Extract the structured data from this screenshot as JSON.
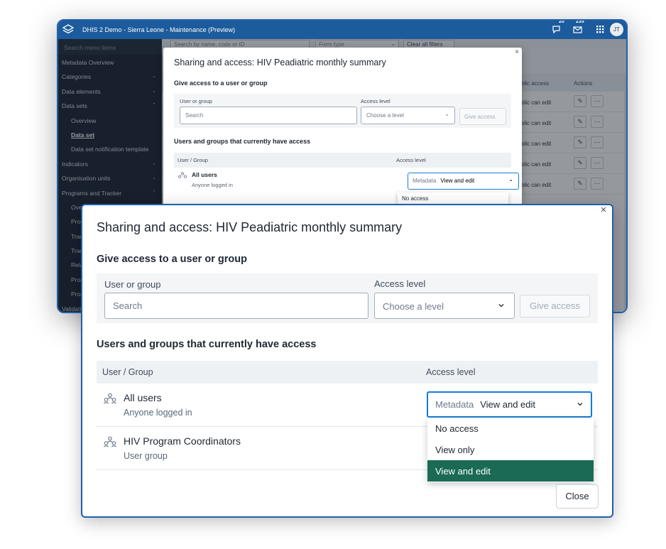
{
  "app": {
    "title": "DHIS 2 Demo - Sierra Leone - Maintenance (Preview)",
    "interpretations_count": "20",
    "messages_count": "235",
    "avatar_initials": "JT"
  },
  "sidebar": {
    "search_placeholder": "Search menu items",
    "items": [
      {
        "label": "Metadata Overview"
      },
      {
        "label": "Categories"
      },
      {
        "label": "Data elements"
      },
      {
        "label": "Data sets"
      },
      {
        "label": "Overview"
      },
      {
        "label": "Data set"
      },
      {
        "label": "Data set notification template"
      },
      {
        "label": "Indicators"
      },
      {
        "label": "Organisation units"
      },
      {
        "label": "Programs and Tracker"
      },
      {
        "label": "Ove"
      },
      {
        "label": "Prog"
      },
      {
        "label": "Trac"
      },
      {
        "label": "Trac"
      },
      {
        "label": "Rela"
      },
      {
        "label": "Prog"
      },
      {
        "label": "Prog"
      },
      {
        "label": "Validati"
      }
    ]
  },
  "filters": {
    "search_placeholder": "Search by name, code or ID",
    "form_type": "Form type",
    "clear": "Clear all filters"
  },
  "table": {
    "col_public": "blic access",
    "col_actions": "Actions",
    "rows": [
      {
        "public": "blic can edit"
      },
      {
        "public": "blic can edit"
      },
      {
        "public": "blic can edit"
      },
      {
        "public": "blic can edit"
      },
      {
        "public": "blic can edit"
      }
    ]
  },
  "small_modal": {
    "title": "Sharing and access: HIV Peadiatric monthly summary",
    "give_title": "Give access to a user or group",
    "user_label": "User or group",
    "search_placeholder": "Search",
    "level_label": "Access level",
    "level_placeholder": "Choose a level",
    "give_button": "Give access",
    "current_title": "Users and groups that currently have access",
    "col_user": "User / Group",
    "col_level": "Access level",
    "row_name": "All users",
    "row_sub": "Anyone logged in",
    "select_prefix": "Metadata",
    "select_value": "View and edit",
    "dropdown_first": "No access"
  },
  "modal": {
    "title": "Sharing and access: HIV Peadiatric monthly summary",
    "give_title": "Give access to a user or group",
    "user_label": "User or group",
    "search_placeholder": "Search",
    "level_label": "Access level",
    "level_placeholder": "Choose a level",
    "give_button": "Give access",
    "current_title": "Users and groups that currently have access",
    "col_user": "User / Group",
    "col_level": "Access level",
    "rows": [
      {
        "name": "All users",
        "sub": "Anyone logged in",
        "icon": "users-icon",
        "select_prefix": "Metadata",
        "select_value": "View and edit"
      },
      {
        "name": "HIV Program Coordinators",
        "sub": "User group",
        "icon": "users-icon"
      }
    ],
    "dropdown_options": [
      "No access",
      "View only",
      "View and edit"
    ],
    "selected_option": "View and edit",
    "close_button": "Close",
    "close_icon": "close-icon"
  },
  "colors": {
    "header_blue": "#1c5b9c",
    "sidebar_dark": "#1b2430",
    "focus_blue": "#147cd7",
    "selected_green": "#1a6a55",
    "border_blue": "#1f5fae"
  }
}
